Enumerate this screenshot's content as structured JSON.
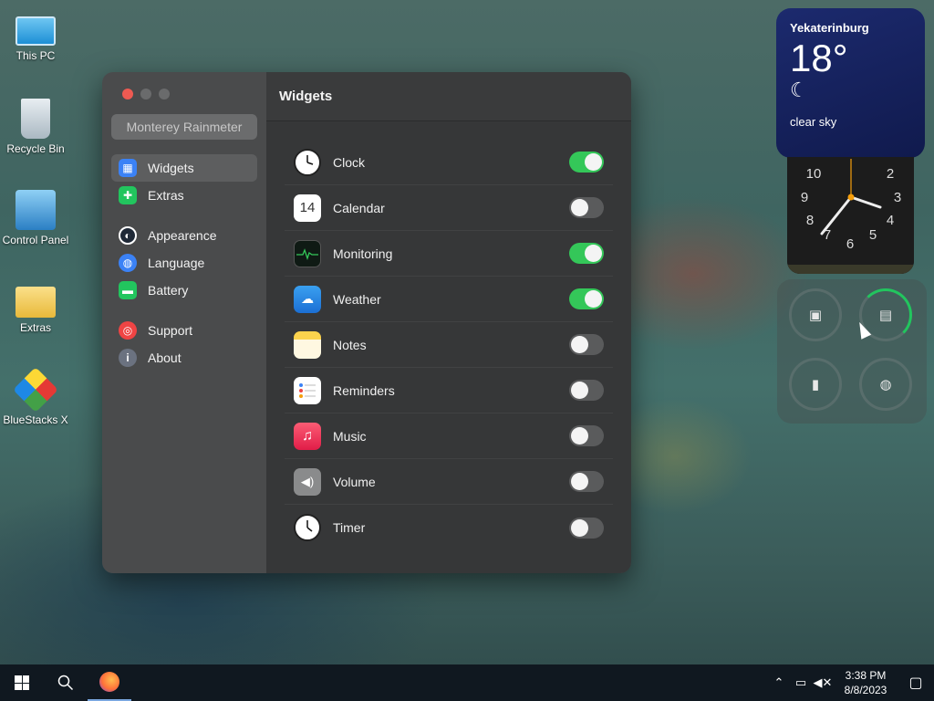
{
  "desktop": {
    "icons": [
      {
        "label": "This PC"
      },
      {
        "label": "Recycle Bin"
      },
      {
        "label": "Control Panel"
      },
      {
        "label": "Extras"
      },
      {
        "label": "BlueStacks X"
      }
    ]
  },
  "window": {
    "app_name": "Monterey Rainmeter",
    "header_title": "Widgets",
    "sidebar": {
      "items": [
        {
          "label": "Widgets",
          "icon": "widgets-icon",
          "color": "#3b82f6",
          "active": true
        },
        {
          "label": "Extras",
          "icon": "puzzle-icon",
          "color": "#22c55e"
        },
        {
          "label": "Appearence",
          "icon": "appearance-icon",
          "color": "#1f2937"
        },
        {
          "label": "Language",
          "icon": "globe-icon",
          "color": "#3b82f6"
        },
        {
          "label": "Battery",
          "icon": "battery-icon",
          "color": "#22c55e"
        },
        {
          "label": "Support",
          "icon": "lifebuoy-icon",
          "color": "#ef4444"
        },
        {
          "label": "About",
          "icon": "info-icon",
          "color": "#6b7280"
        }
      ]
    },
    "widgets": [
      {
        "label": "Clock",
        "enabled": true
      },
      {
        "label": "Calendar",
        "enabled": false,
        "icon_text": "14"
      },
      {
        "label": "Monitoring",
        "enabled": true
      },
      {
        "label": "Weather",
        "enabled": true
      },
      {
        "label": "Notes",
        "enabled": false
      },
      {
        "label": "Reminders",
        "enabled": false
      },
      {
        "label": "Music",
        "enabled": false
      },
      {
        "label": "Volume",
        "enabled": false
      },
      {
        "label": "Timer",
        "enabled": false
      }
    ]
  },
  "weather_widget": {
    "city": "Yekaterinburg",
    "temperature": "18°",
    "condition": "clear sky",
    "icon": "moon-icon"
  },
  "clock_widget": {
    "numbers": [
      "10",
      "2",
      "9",
      "3",
      "8",
      "4",
      "7",
      "6",
      "5"
    ]
  },
  "taskbar": {
    "time": "3:38 PM",
    "date": "8/8/2023"
  }
}
